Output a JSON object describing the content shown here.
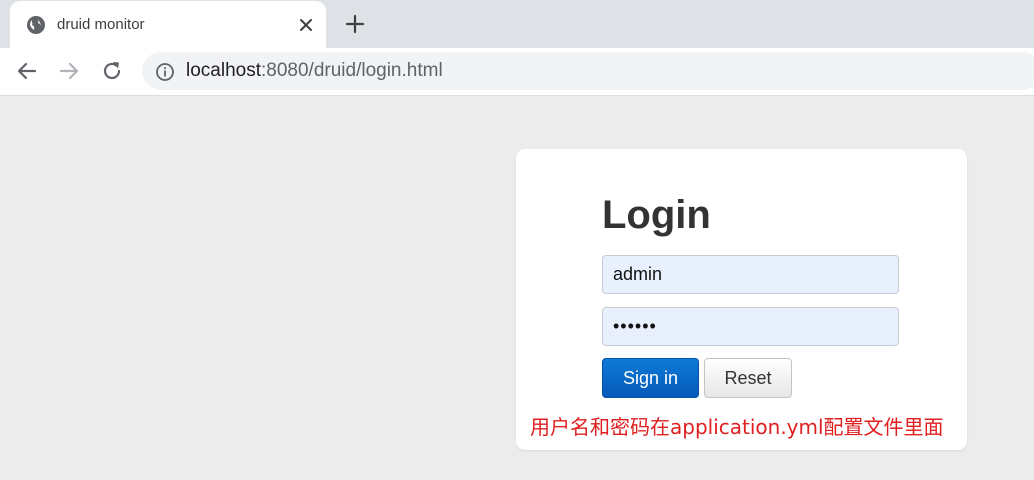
{
  "browser": {
    "tab": {
      "title": "druid monitor",
      "favicon": "globe-icon",
      "close_icon": "close-icon"
    },
    "new_tab_icon": "plus-icon",
    "toolbar": {
      "back_icon": "back-arrow-icon",
      "forward_icon": "forward-arrow-icon",
      "reload_icon": "reload-icon",
      "info_icon": "info-icon",
      "url_host": "localhost",
      "url_rest": ":8080/druid/login.html"
    }
  },
  "login": {
    "heading": "Login",
    "username_value": "admin",
    "password_value": "••••••",
    "sign_in_label": "Sign in",
    "reset_label": "Reset",
    "note": "用户名和密码在application.yml配置文件里面",
    "note_color": "#e02020",
    "sign_in_color": "#0563c1"
  }
}
